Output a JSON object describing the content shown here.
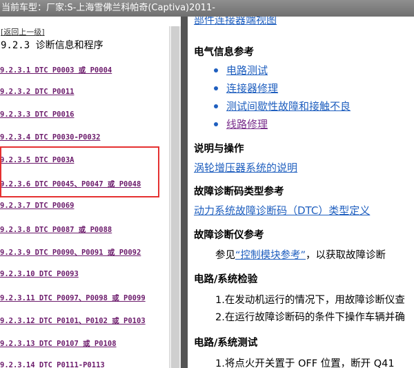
{
  "window": {
    "title": "当前车型：厂家:S-上海雪佛兰科帕奇(Captiva)2011-"
  },
  "left_pane": {
    "back_link": "[返回上一级]",
    "section_title": "9.2.3 诊断信息和程序",
    "items": [
      "9.2.3.1 DTC P0003 或 P0004",
      "9.2.3.2 DTC P0011",
      "9.2.3.3 DTC P0016",
      "9.2.3.4 DTC P0030-P0032",
      "9.2.3.5 DTC P003A",
      "9.2.3.6 DTC P0045、P0047 或 P0048",
      "9.2.3.7 DTC P0069",
      "9.2.3.8 DTC P0087 或 P0088",
      "9.2.3.9 DTC P0090、P0091 或 P0092",
      "9.2.3.10 DTC P0093",
      "9.2.3.11 DTC P0097、P0098 或 P0099",
      "9.2.3.12 DTC P0101、P0102 或 P0103",
      "9.2.3.13 DTC P0107 或 P0108",
      "9.2.3.14 DTC P0111-P0113"
    ]
  },
  "right_pane": {
    "cut_link": "部件连接器端视图",
    "electrical_heading": "电气信息参考",
    "electrical_links": [
      "电路测试",
      "连接器修理",
      "测试间歇性故障和接触不良",
      "线路修理"
    ],
    "description_heading": "说明与操作",
    "description_link": "涡轮增压器系统的说明",
    "dtc_type_heading": "故障诊断码类型参考",
    "dtc_type_link": "动力系统故障诊断码（DTC）类型定义",
    "scan_tool_heading": "故障诊断仪参考",
    "scan_tool_prefix": "参见",
    "scan_tool_link": "“控制模块参考”",
    "scan_tool_suffix": "，以获取故障诊断",
    "verify_heading": "电路/系统检验",
    "verify_steps": [
      "1.在发动机运行的情况下，用故障诊断仪查",
      "2.在运行故障诊断码的条件下操作车辆并确"
    ],
    "test_heading": "电路/系统测试",
    "test_steps": [
      "1.将点火开关置于 OFF 位置，断开 Q41"
    ]
  },
  "colors": {
    "link_blue": "#1f5fbf",
    "visited_purple": "#7a2e8c",
    "toc_link": "#6b1a6b",
    "highlight_red": "#e53030"
  }
}
